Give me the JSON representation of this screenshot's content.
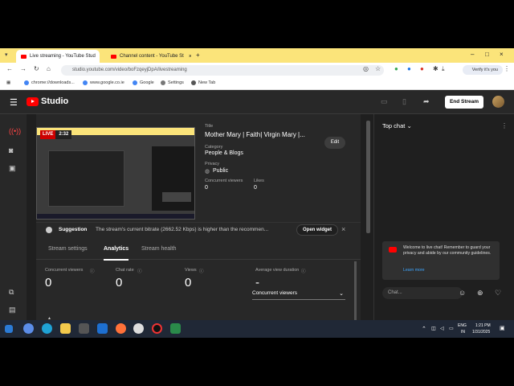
{
  "browser": {
    "tabs": [
      {
        "label": "Live streaming - YouTube Stud"
      },
      {
        "label": "Channel content - YouTube St"
      }
    ],
    "url": "studio.youtube.com/video/boFzqeyjDpA/livestreaming",
    "bookmarks": [
      "chrome://downloads...",
      "www.google.co.ie",
      "Google",
      "Settings",
      "New Tab"
    ],
    "verify_label": "Verify it's you"
  },
  "header": {
    "logo_text": "Studio",
    "end_stream_label": "End Stream"
  },
  "stream": {
    "live_label": "LIVE",
    "time": "2:32",
    "title_label": "Title",
    "title": "Mother Mary | Faith| Virgin Mary |...",
    "category_label": "Category",
    "category": "People & Blogs",
    "privacy_label": "Privacy",
    "privacy": "Public",
    "concurrent_label": "Concurrent viewers",
    "concurrent": "0",
    "likes_label": "Likes",
    "likes": "0",
    "edit_label": "Edit"
  },
  "suggestion": {
    "label": "Suggestion",
    "text": "The stream's current bitrate (2662.52 Kbps) is higher than the recommen...",
    "open_widget": "Open widget"
  },
  "tabs": [
    "Stream settings",
    "Analytics",
    "Stream health"
  ],
  "metrics": [
    {
      "label": "Concurrent viewers",
      "value": "0"
    },
    {
      "label": "Chat rate",
      "value": "0"
    },
    {
      "label": "Views",
      "value": "0"
    },
    {
      "label": "Average view duration",
      "value": "-"
    }
  ],
  "metric_select": "Concurrent viewers",
  "chat": {
    "header": "Top chat",
    "welcome": "Welcome to live chat! Remember to guard your privacy and abide by our community guidelines.",
    "learn_more": "Learn more",
    "input_placeholder": "Chat..."
  },
  "taskbar": {
    "lang1": "ENG",
    "lang2": "IN",
    "time": "1:21 PM",
    "date": "1/31/2025"
  }
}
